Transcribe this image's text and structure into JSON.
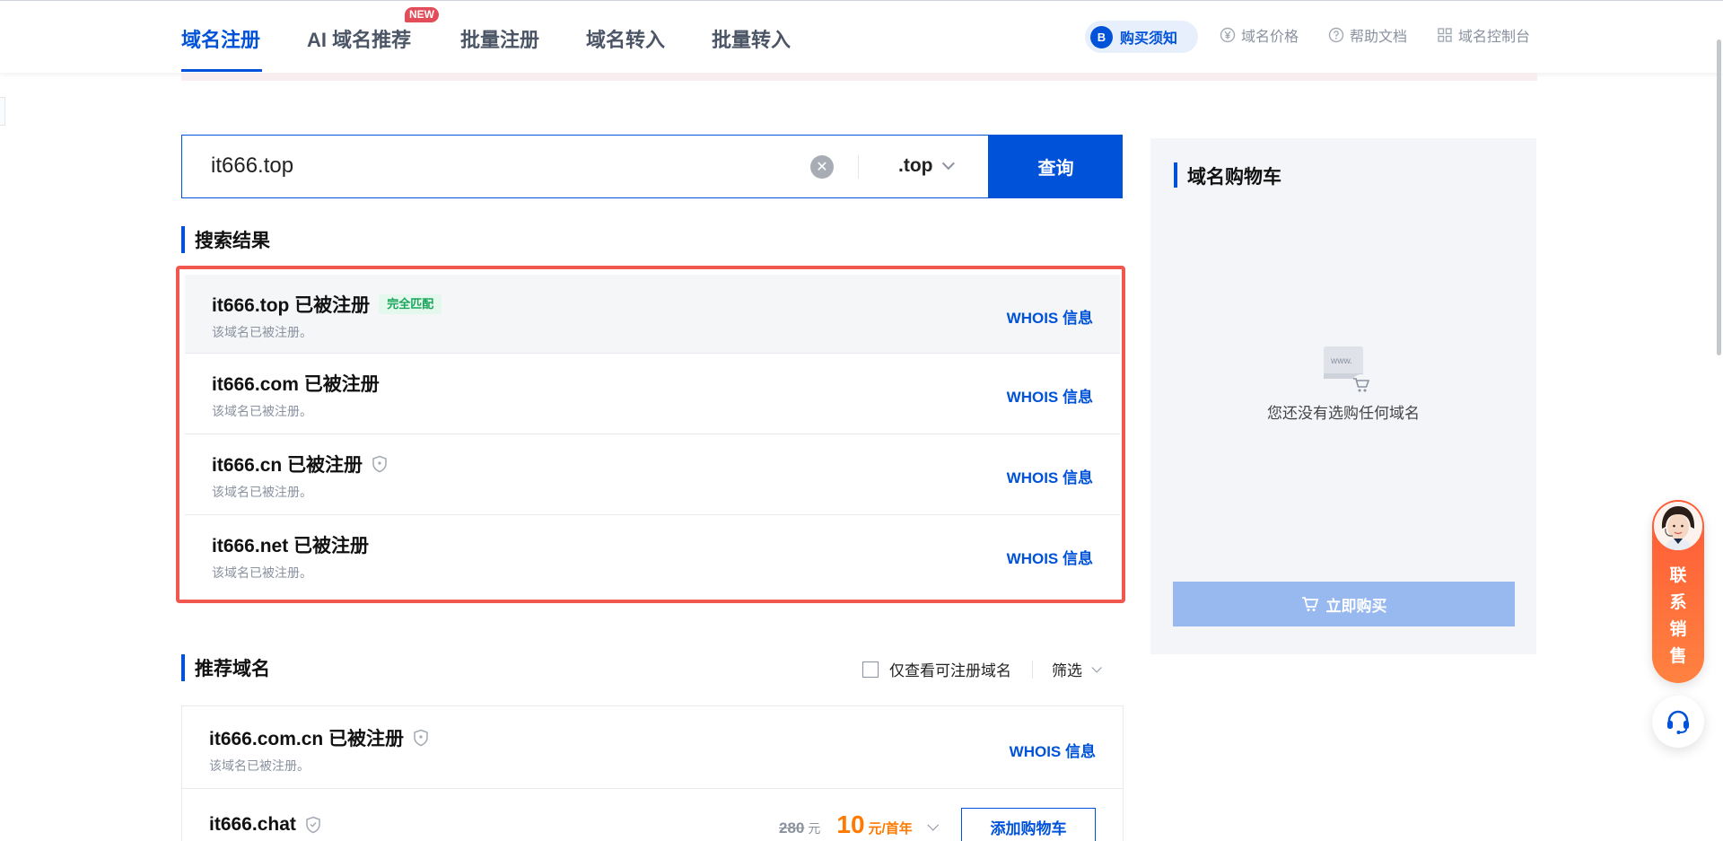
{
  "nav": {
    "tabs": [
      {
        "label": "域名注册"
      },
      {
        "label": "AI 域名推荐",
        "badge": "NEW"
      },
      {
        "label": "批量注册"
      },
      {
        "label": "域名转入"
      },
      {
        "label": "批量转入"
      }
    ],
    "notice_badge": "B",
    "notice_label": "购买须知",
    "links": [
      {
        "label": "域名价格",
        "icon": "yen-circle-icon"
      },
      {
        "label": "帮助文档",
        "icon": "help-circle-icon"
      },
      {
        "label": "域名控制台",
        "icon": "grid-icon"
      }
    ]
  },
  "search": {
    "value": "it666.top",
    "suffix": ".top",
    "button": "查询",
    "clear_symbol": "✕"
  },
  "results": {
    "title": "搜索结果",
    "items": [
      {
        "domain": "it666.top 已被注册",
        "badge": "完全匹配",
        "note": "该域名已被注册。",
        "action": "WHOIS 信息"
      },
      {
        "domain": "it666.com 已被注册",
        "note": "该域名已被注册。",
        "action": "WHOIS 信息"
      },
      {
        "domain": "it666.cn 已被注册",
        "shield": true,
        "note": "该域名已被注册。",
        "action": "WHOIS 信息"
      },
      {
        "domain": "it666.net 已被注册",
        "note": "该域名已被注册。",
        "action": "WHOIS 信息"
      }
    ]
  },
  "recommend": {
    "title": "推荐域名",
    "filter_checkbox": "仅查看可注册域名",
    "filter": "筛选",
    "items": [
      {
        "domain": "it666.com.cn 已被注册",
        "note": "该域名已被注册。",
        "action": "WHOIS 信息"
      },
      {
        "domain": "it666.chat",
        "price_old": "280",
        "price_old_unit": "元",
        "price": "10",
        "price_unit": "元/首年",
        "action": "添加购物车"
      }
    ]
  },
  "cart": {
    "title": "域名购物车",
    "empty_icon_text": "www.",
    "empty_text": "您还没有选购任何域名",
    "buy_button": "立即购买"
  },
  "float": {
    "contact_label": [
      "联",
      "系",
      "销",
      "售"
    ]
  },
  "colors": {
    "primary": "#0052d9",
    "highlight_border": "#f0584f",
    "price": "#ff7a00",
    "match_badge": "#19a55a",
    "contact_gradient": "#ff5a36"
  }
}
